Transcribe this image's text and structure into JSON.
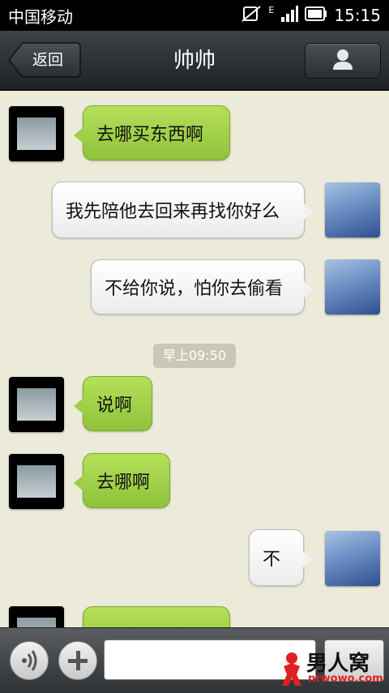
{
  "status_bar": {
    "carrier": "中国移动",
    "time": "15:15",
    "icons": [
      "mute-icon",
      "signal-icon",
      "battery-icon"
    ]
  },
  "header": {
    "back_label": "返回",
    "title": "帅帅",
    "profile_icon": "person-icon"
  },
  "messages": [
    {
      "side": "left",
      "avatar": "car-avatar",
      "text": "去哪买东西啊"
    },
    {
      "side": "right",
      "avatar": "girl-avatar",
      "text": "我先陪他去回来再找你好么"
    },
    {
      "side": "right",
      "avatar": "girl-avatar",
      "text": "不给你说，怕你去偷看"
    },
    {
      "type": "time",
      "text": "早上09:50"
    },
    {
      "side": "left",
      "avatar": "car-avatar",
      "text": "说啊"
    },
    {
      "side": "left",
      "avatar": "car-avatar",
      "text": "去哪啊"
    },
    {
      "side": "right",
      "avatar": "girl-avatar",
      "text": "不"
    },
    {
      "side": "left",
      "avatar": "car-avatar",
      "text": ""
    }
  ],
  "input_bar": {
    "voice_icon": "voice-icon",
    "plus_icon": "plus-icon",
    "input_value": "",
    "input_placeholder": ""
  },
  "watermark": {
    "text": "男人窝",
    "sub": "nrwowo.com"
  },
  "colors": {
    "chat_background": "#ecebd9",
    "left_bubble": "#9fce45",
    "right_bubble": "#f4f4f4",
    "header": "#2b2f32"
  }
}
